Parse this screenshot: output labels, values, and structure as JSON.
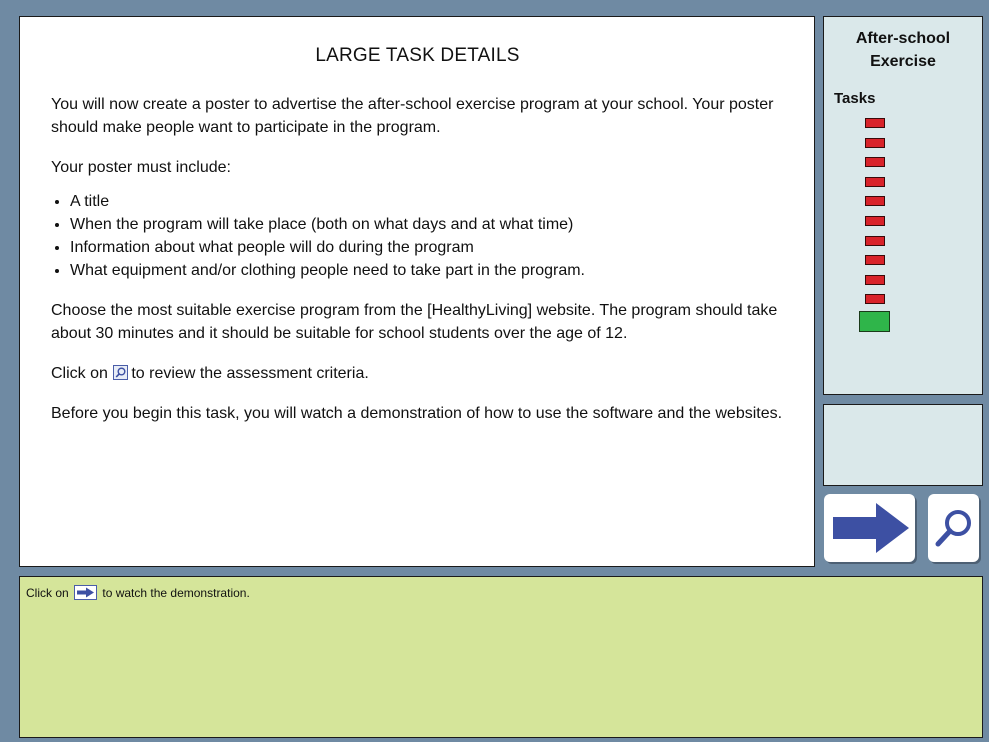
{
  "main": {
    "title": "LARGE TASK DETAILS",
    "intro": "You will now create a poster to advertise the after-school exercise program at your school. Your poster should make people want to participate in the program.",
    "must_include_label": "Your poster must include:",
    "requirements": [
      "A title",
      "When the program will take place (both on what days and at what time)",
      "Information about what people will do during the program",
      "What equipment and/or clothing people need to take part in the program."
    ],
    "choose_text": "Choose the most suitable exercise program from the [HealthyLiving] website. The program should take about 30 minutes and it should be suitable for school students over the age of 12.",
    "review_prefix": "Click on",
    "review_suffix": "to review the assessment criteria.",
    "demo_text": "Before you begin this task, you will watch a demonstration of how to use the software and the websites."
  },
  "sidebar": {
    "title": "After-school Exercise",
    "tasks_label": "Tasks",
    "task_count": 11,
    "task_marker_color": "#d8232a",
    "current_marker_color": "#2fb54a"
  },
  "buttons": {
    "next_icon": "right-arrow-icon",
    "review_icon": "magnifier-icon",
    "icon_color": "#3d50a3"
  },
  "instruction": {
    "prefix": "Click on",
    "suffix": "to watch the demonstration."
  }
}
